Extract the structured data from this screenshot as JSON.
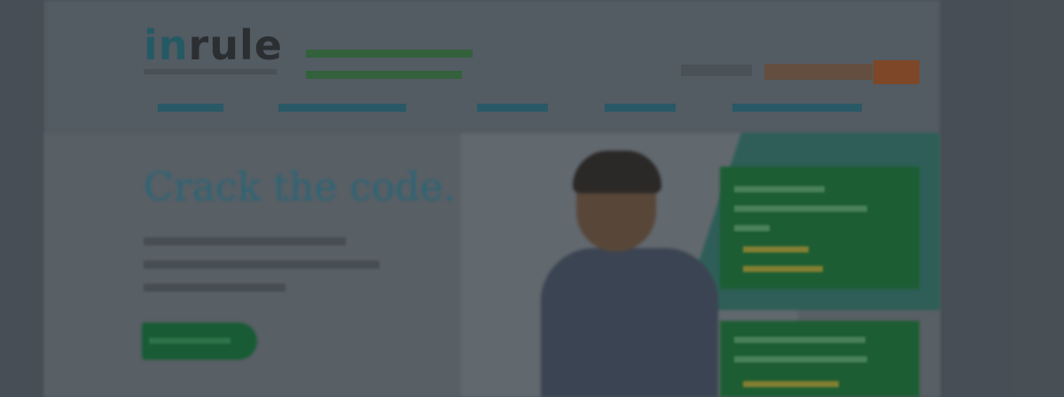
{
  "brand": {
    "logo_in": "in",
    "logo_rule": "rule"
  },
  "hero": {
    "headline": "Crack the code."
  },
  "colors": {
    "brand_teal": "#25606c",
    "cta_green": "#166136",
    "search_orange": "#8a4a26",
    "promo_green": "#1c6434"
  }
}
